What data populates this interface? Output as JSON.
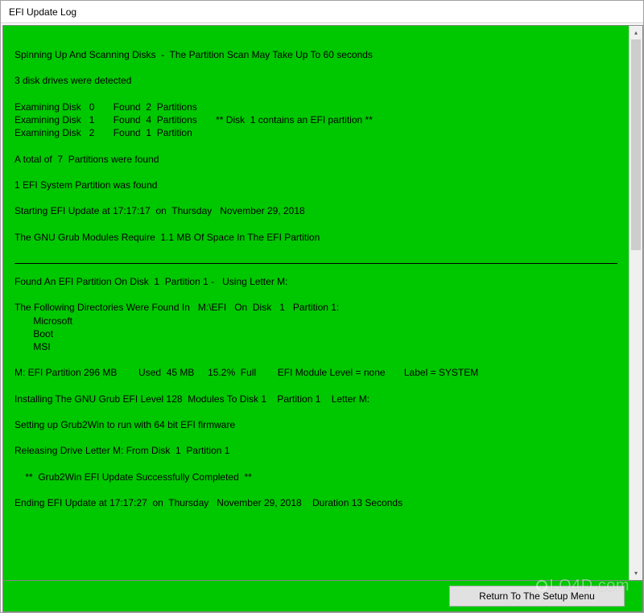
{
  "window": {
    "title": "EFI Update Log"
  },
  "log": {
    "lines": [
      "Spinning Up And Scanning Disks  -  The Partition Scan May Take Up To 60 seconds",
      "",
      "3 disk drives were detected",
      "",
      "Examining Disk   0       Found  2  Partitions",
      "Examining Disk   1       Found  4  Partitions       ** Disk  1 contains an EFI partition **",
      "Examining Disk   2       Found  1  Partition",
      "",
      "A total of  7  Partitions were found",
      "",
      "1 EFI System Partition was found",
      "",
      "Starting EFI Update at 17:17:17  on  Thursday   November 29, 2018",
      "",
      "The GNU Grub Modules Require  1.1 MB Of Space In The EFI Partition",
      ""
    ],
    "lines2": [
      "Found An EFI Partition On Disk  1  Partition 1 -   Using Letter M:",
      "",
      "The Following Directories Were Found In   M:\\EFI   On  Disk   1   Partition 1:",
      "       Microsoft",
      "       Boot",
      "       MSI",
      "",
      "M: EFI Partition 296 MB        Used  45 MB     15.2%  Full        EFI Module Level = none       Label = SYSTEM",
      "",
      "Installing The GNU Grub EFI Level 128  Modules To Disk 1    Partition 1    Letter M:",
      "",
      "Setting up Grub2Win to run with 64 bit EFI firmware",
      "",
      "Releasing Drive Letter M: From Disk  1  Partition 1",
      "",
      "    **  Grub2Win EFI Update Successfully Completed  **",
      "",
      "Ending EFI Update at 17:17:27  on  Thursday   November 29, 2018    Duration 13 Seconds"
    ]
  },
  "footer": {
    "return_label": "Return To The Setup Menu"
  },
  "watermark": {
    "text": "LO4D.com"
  }
}
